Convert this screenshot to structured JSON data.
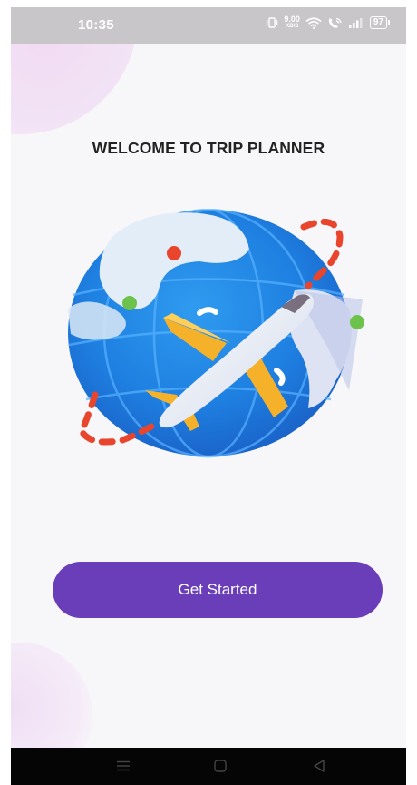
{
  "status_bar": {
    "time": "10:35",
    "net_speed_value": "9.00",
    "net_speed_unit": "KB/S",
    "battery": "97"
  },
  "welcome": {
    "title": "WELCOME TO TRIP PLANNER"
  },
  "actions": {
    "get_started_label": "Get Started"
  },
  "colors": {
    "primary": "#6a3eb8",
    "globe": "#1e7fe0",
    "route": "#e8452c",
    "plane_wing": "#f6b12b"
  },
  "icons": {
    "status": [
      "vibrate-icon",
      "wifi-icon",
      "volte-call-icon",
      "signal-icon",
      "battery-icon"
    ],
    "navigation": [
      "menu-icon",
      "home-icon",
      "back-icon"
    ]
  }
}
